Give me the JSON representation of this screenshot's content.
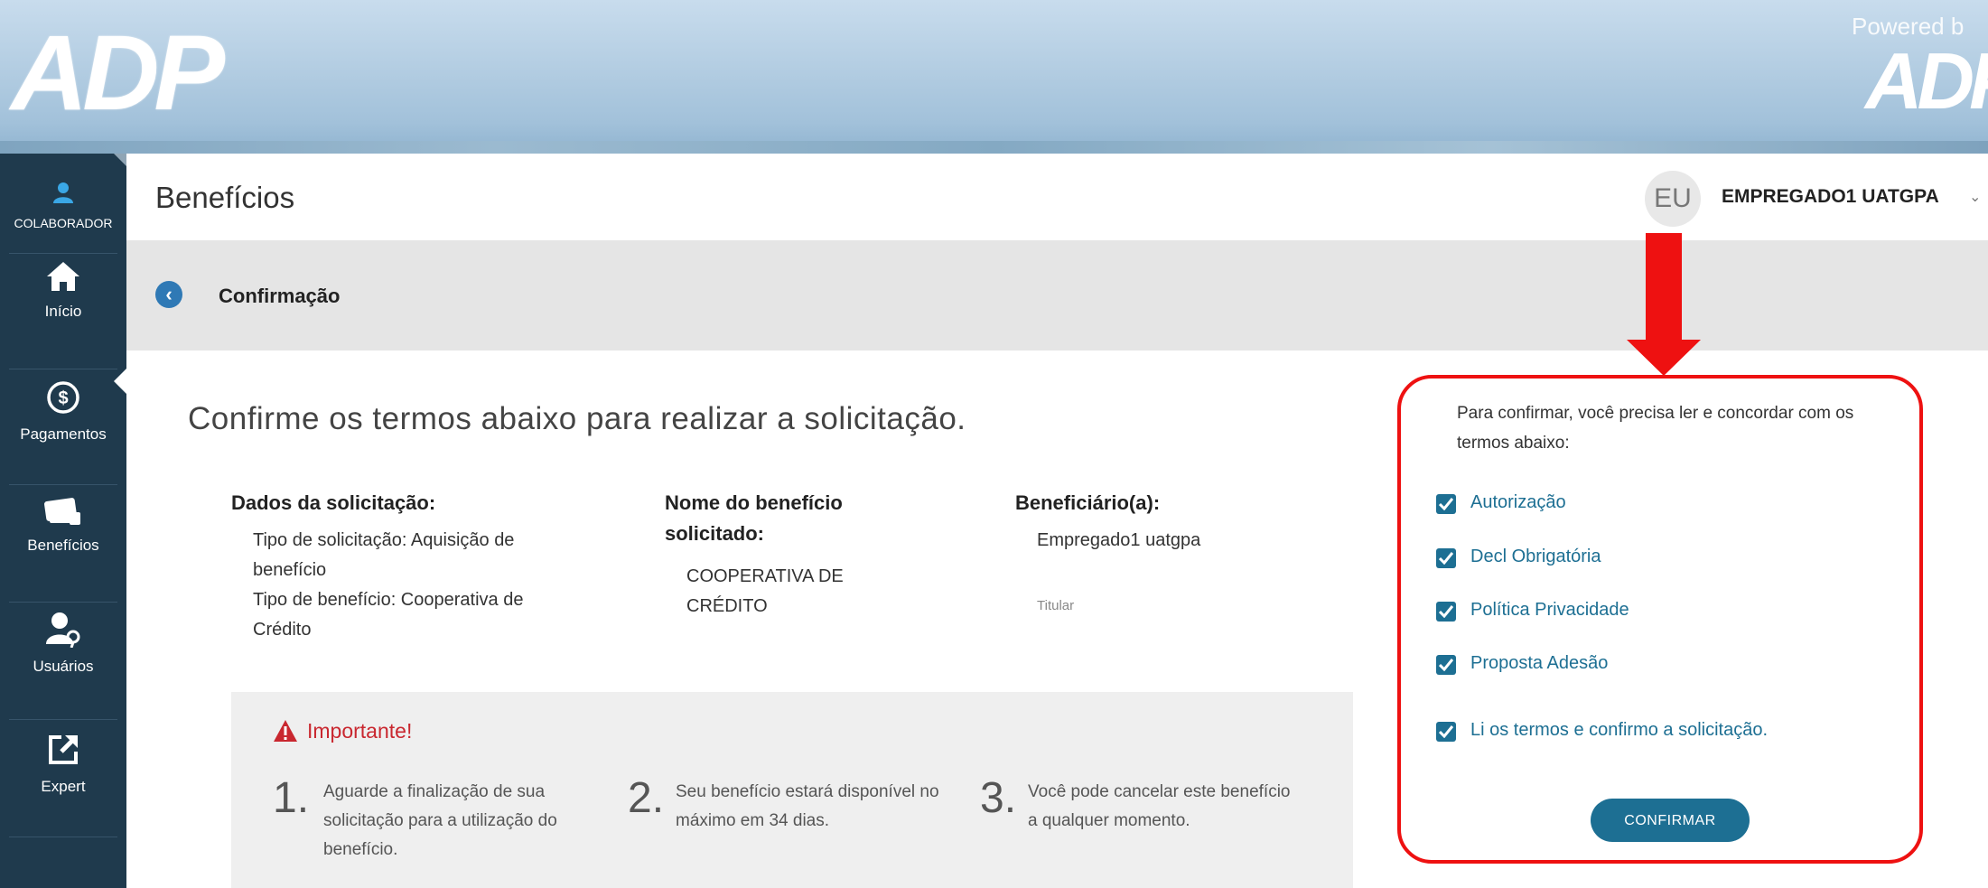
{
  "banner": {
    "logo_text": "ADP",
    "powered_label": "Powered b",
    "logo_small_text": "ADP"
  },
  "sidebar": {
    "items": [
      {
        "label": "COLABORADOR",
        "icon": "user-icon"
      },
      {
        "label": "Início",
        "icon": "home-icon"
      },
      {
        "label": "Pagamentos",
        "icon": "dollar-icon"
      },
      {
        "label": "Benefícios",
        "icon": "card-icon",
        "active": true
      },
      {
        "label": "Usuários",
        "icon": "users-icon"
      },
      {
        "label": "Expert",
        "icon": "external-link-icon"
      }
    ]
  },
  "header": {
    "title": "Benefícios",
    "avatar_initials": "EU",
    "user_name": "EMPREGADO1 UATGPA"
  },
  "subbar": {
    "title": "Confirmação"
  },
  "main": {
    "heading": "Confirme os termos abaixo para realizar a solicitação.",
    "request_data": {
      "heading": "Dados da solicitação:",
      "line1": "Tipo de solicitação: Aquisição de benefício",
      "line2": "Tipo de benefício: Cooperativa de Crédito"
    },
    "benefit_name": {
      "heading": "Nome do benefício solicitado:",
      "value": "COOPERATIVA DE CRÉDITO"
    },
    "beneficiary": {
      "heading": "Beneficiário(a):",
      "value": "Empregado1 uatgpa",
      "role": "Titular"
    },
    "important": {
      "title": "Importante!",
      "steps": [
        {
          "num": "1.",
          "text": "Aguarde a finalização de sua solicitação para a utilização do benefício."
        },
        {
          "num": "2.",
          "text": "Seu benefício estará disponível no máximo em 34 dias."
        },
        {
          "num": "3.",
          "text": "Você pode cancelar este benefício a qualquer momento."
        }
      ]
    }
  },
  "confirm_panel": {
    "intro": "Para confirmar, você precisa ler e concordar com os termos abaixo:",
    "checkboxes": [
      {
        "label": "Autorização",
        "checked": true
      },
      {
        "label": "Decl Obrigatória",
        "checked": true
      },
      {
        "label": "Política Privacidade",
        "checked": true
      },
      {
        "label": "Proposta Adesão",
        "checked": true
      },
      {
        "label": "Li os termos e confirmo a solicitação.",
        "checked": true
      }
    ],
    "button_label": "CONFIRMAR"
  },
  "colors": {
    "sidebar_bg": "#1f3a4d",
    "accent": "#1d6f93",
    "back_button": "#2f79b5",
    "highlight_red": "#ee1111",
    "important_red": "#c9272f"
  }
}
